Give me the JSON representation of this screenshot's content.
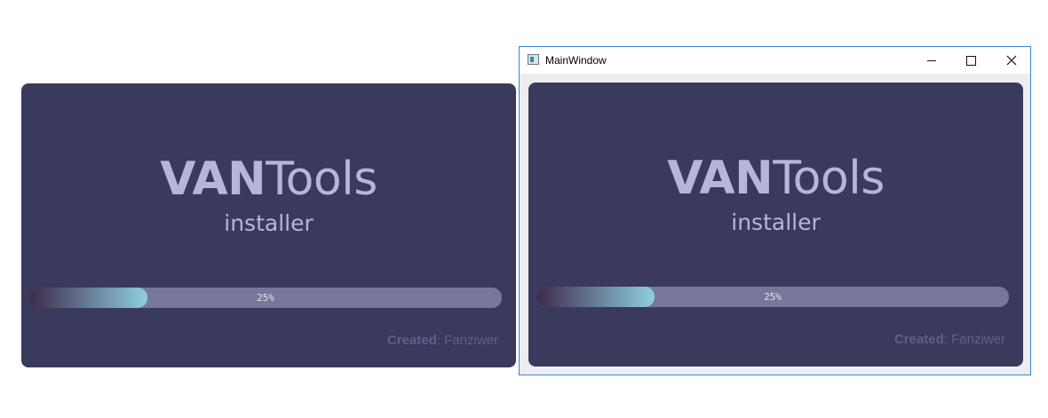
{
  "splash": {
    "title_bold": "VAN",
    "title_light": "Tools",
    "subtitle": "installer",
    "progress_value": 0.25,
    "progress_text": "25%",
    "credit_label": "Created",
    "credit_sep": ": ",
    "credit_name": "Fanziwer"
  },
  "window": {
    "title": "MainWindow",
    "app_icon": "app-window-icon",
    "minimize_icon": "minimize-icon",
    "maximize_icon": "maximize-icon",
    "close_icon": "close-icon",
    "progress_value": 0.25
  },
  "colors": {
    "card_bg": "#3a3a5c",
    "title": "#b6b7d8",
    "track": "#77779a",
    "fill_start": "#3d2a4a",
    "fill_end": "#8fcfdf",
    "credit": "#5f5f91"
  }
}
